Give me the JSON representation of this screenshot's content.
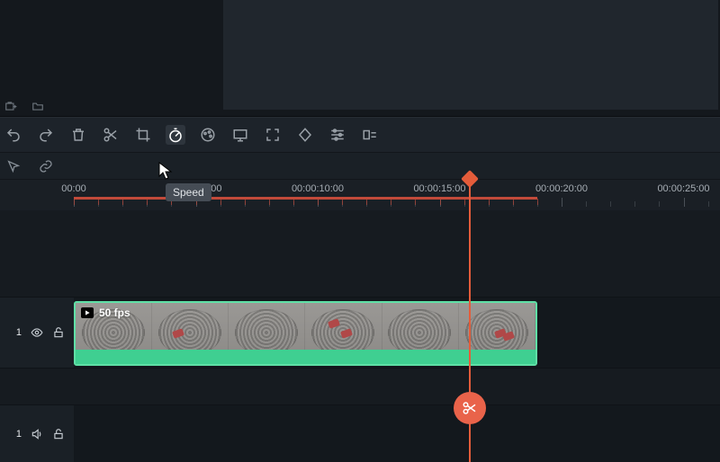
{
  "toolbar": {
    "tooltip": "Speed"
  },
  "ruler": {
    "times": [
      "00:00",
      "00:00:05:00",
      "00:00:10:00",
      "00:00:15:00",
      "00:00:20:00",
      "00:00:25:00"
    ],
    "pxStart": 82,
    "pxPerSecond": 27.1,
    "rangeEndSeconds": 19,
    "playheadSeconds": 16.2
  },
  "clip": {
    "fpsLabel": "50 fps",
    "startSeconds": 0,
    "durationSeconds": 19
  },
  "videoTrack": {
    "index": "1"
  },
  "audioTrack": {
    "index": "1"
  }
}
